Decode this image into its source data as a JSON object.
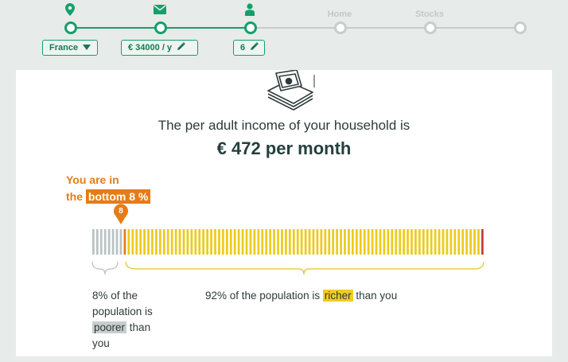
{
  "stepper": {
    "steps": [
      {
        "icon": "location-pin-icon",
        "status": "done"
      },
      {
        "icon": "envelope-icon",
        "status": "done"
      },
      {
        "icon": "person-icon",
        "status": "current"
      },
      {
        "label": "Home",
        "status": "todo"
      },
      {
        "label": "Stocks",
        "status": "todo"
      },
      {
        "label": "",
        "status": "todo"
      }
    ],
    "country": "France",
    "income": "€ 34000 / y",
    "household_size": "6"
  },
  "result": {
    "intro": "The per adult income of your household is",
    "amount": "€ 472 per month",
    "you_are_in": "You are in",
    "the": "the",
    "bottom_label": "bottom 8 %",
    "marker_value": "8",
    "poorer_part1": "8% of the population is",
    "poorer_highlight": "poorer",
    "poorer_part2": "than you",
    "richer_part1": "92% of the population is",
    "richer_highlight": "richer",
    "richer_part2": "than you"
  },
  "distribution": {
    "total_bars": 100,
    "poorer_percent": 8,
    "colors": {
      "poorer": "#b9c2c3",
      "you": "#e67c17",
      "richer": "#eccb1c",
      "top": "#c83a2a"
    }
  },
  "colors": {
    "accent_green": "#14a06a",
    "accent_orange": "#e67c17",
    "richer_yellow": "#f0cc25",
    "inactive_grey": "#c7cdcc"
  }
}
